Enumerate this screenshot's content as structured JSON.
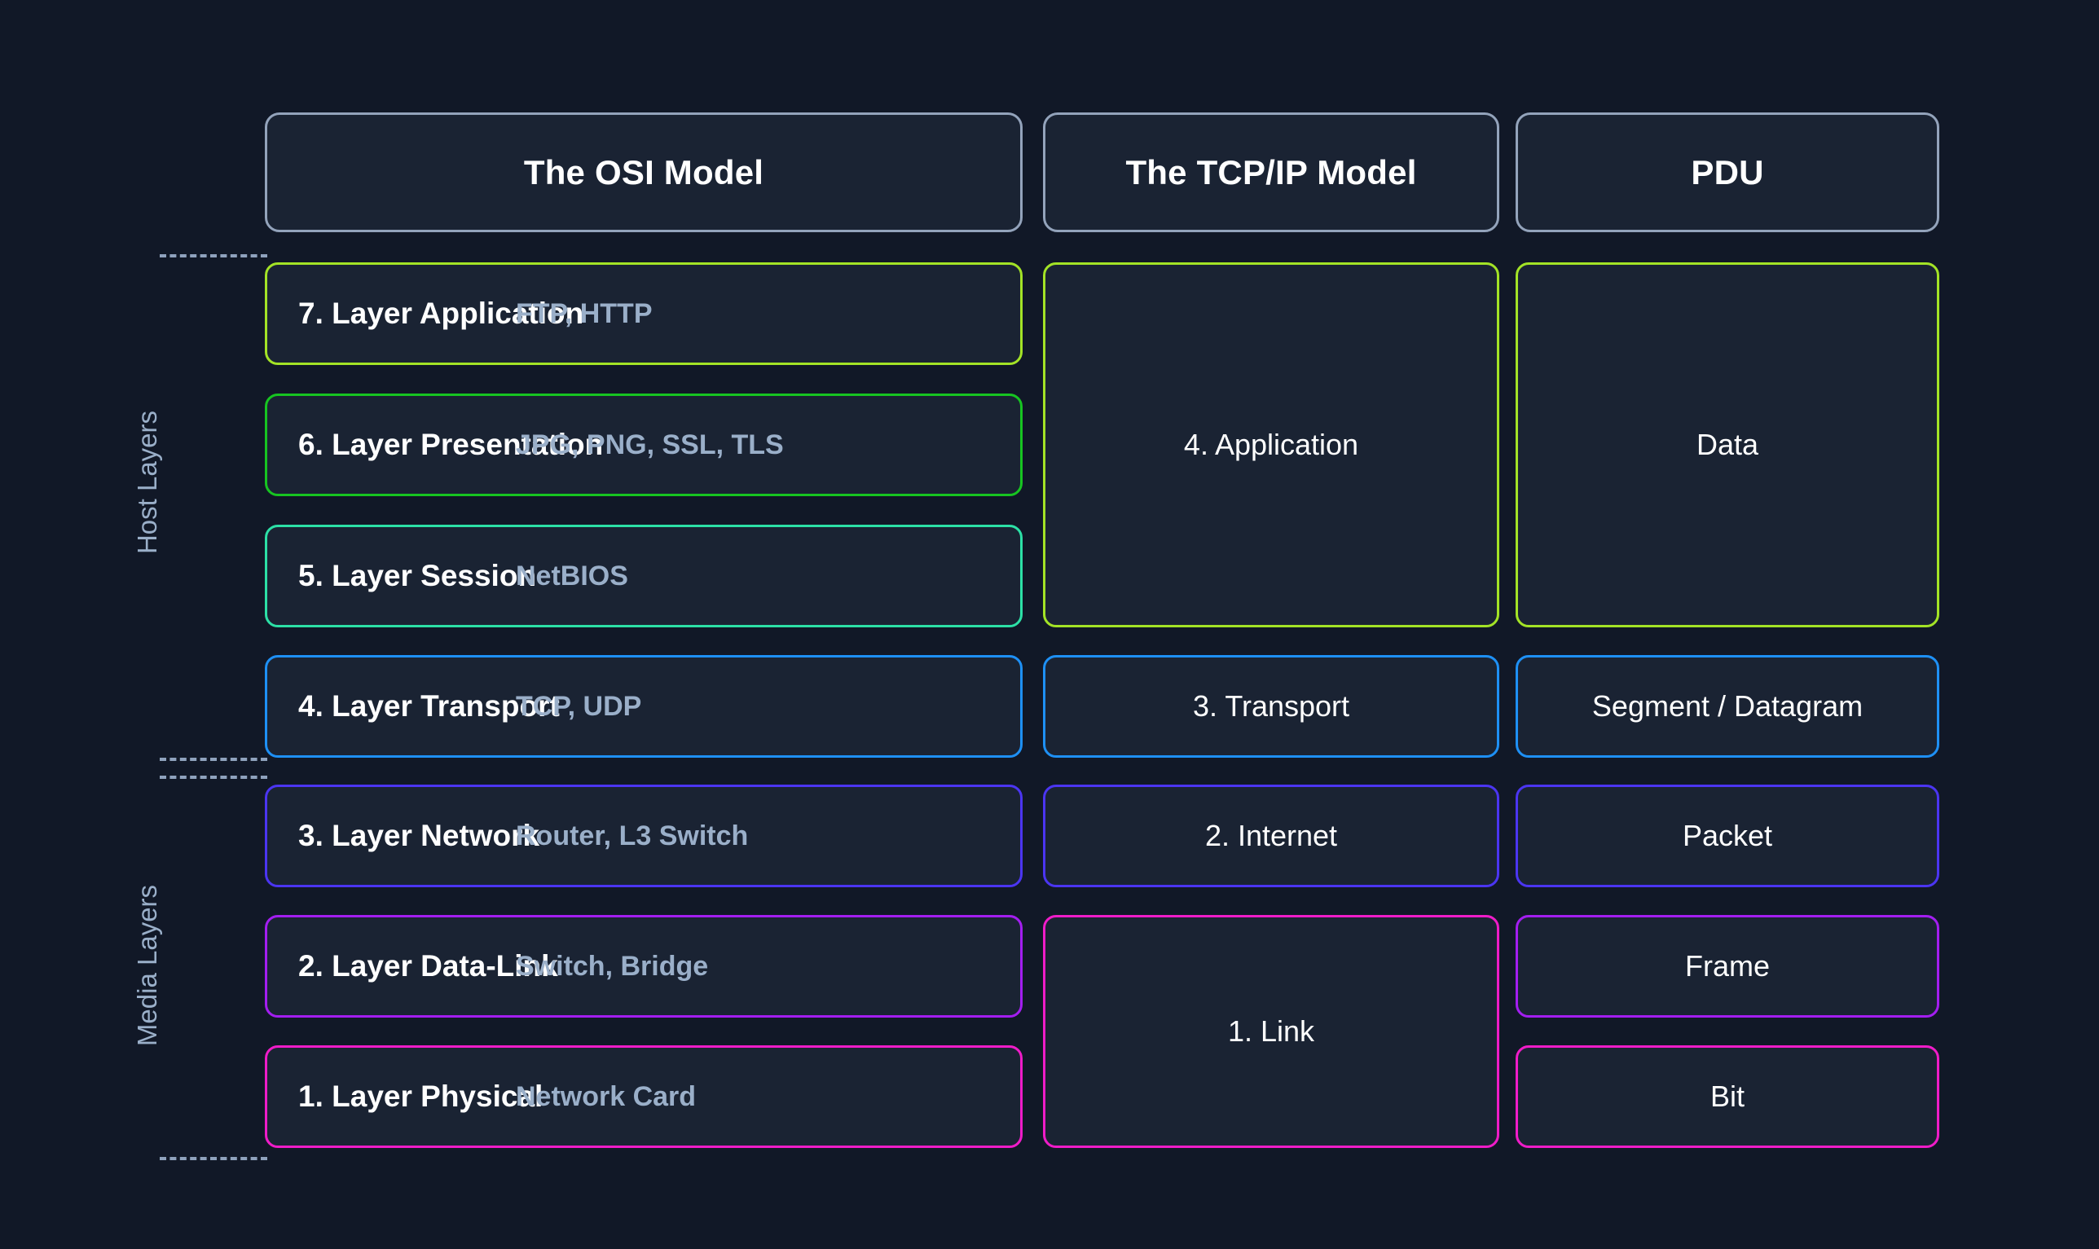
{
  "background_color": "#111827",
  "box_fill_color": "#1a2333",
  "header": {
    "border_color": "#93a3bb",
    "columns": [
      {
        "label": "The OSI Model"
      },
      {
        "label": "The TCP/IP Model"
      },
      {
        "label": "PDU"
      }
    ]
  },
  "groups": [
    {
      "label": "Host Layers"
    },
    {
      "label": "Media Layers"
    }
  ],
  "separator_color": "#8fa2bd",
  "osi_layers": [
    {
      "name": "7. Layer Application",
      "examples": "FTP, HTTP",
      "color": "#a3e326"
    },
    {
      "name": "6. Layer Presentation",
      "examples": "JPG, PNG, SSL, TLS",
      "color": "#17c421"
    },
    {
      "name": "5. Layer Session",
      "examples": "NetBIOS",
      "color": "#2ce0a6"
    },
    {
      "name": "4. Layer Transport",
      "examples": "TCP, UDP",
      "color": "#1e90f5"
    },
    {
      "name": "3. Layer Network",
      "examples": "Router, L3 Switch",
      "color": "#4b35f2"
    },
    {
      "name": "2. Layer Data-Link",
      "examples": "Switch, Bridge",
      "color": "#a31ef0"
    },
    {
      "name": "1. Layer Physical",
      "examples": "Network Card",
      "color": "#ef1cc8"
    }
  ],
  "tcpip_layers": [
    {
      "label": "4. Application",
      "color": "#a3e326"
    },
    {
      "label": "3. Transport",
      "color": "#1e90f5"
    },
    {
      "label": "2. Internet",
      "color": "#4b35f2"
    },
    {
      "label": "1. Link",
      "color": "#ef1cc8"
    }
  ],
  "pdu_layers": [
    {
      "label": "Data",
      "color": "#a3e326"
    },
    {
      "label": "Segment / Datagram",
      "color": "#1e90f5"
    },
    {
      "label": "Packet",
      "color": "#4b35f2"
    },
    {
      "label": "Frame",
      "color": "#a31ef0"
    },
    {
      "label": "Bit",
      "color": "#ef1cc8"
    }
  ]
}
